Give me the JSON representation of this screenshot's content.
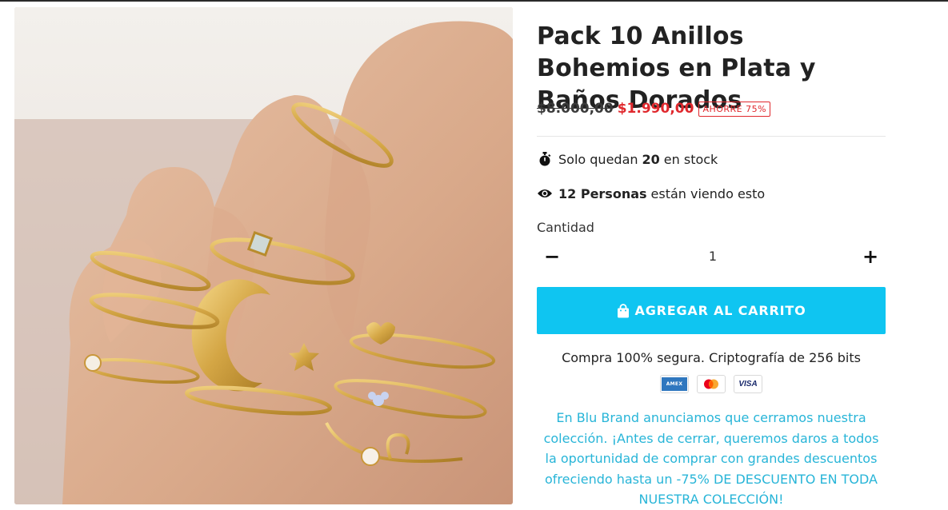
{
  "product": {
    "title": "Pack 10 Anillos Bohemios en Plata y Baños Dorados",
    "image_alt": "rings-on-hand-photo"
  },
  "pricing": {
    "old_price": "$8.000,00",
    "new_price": "$1.990,00",
    "save_badge": "AHORRE 75%"
  },
  "stock": {
    "prefix": "Solo quedan",
    "count": "20",
    "suffix": "en stock",
    "icon": "stopwatch-icon"
  },
  "viewers": {
    "count_label": "12 Personas",
    "suffix": "están viendo esto",
    "icon": "eye-icon"
  },
  "quantity": {
    "label": "Cantidad",
    "value": "1",
    "minus": "−",
    "plus": "+"
  },
  "cart_button": {
    "label": "AGREGAR AL CARRITO",
    "color": "#0fc5f1",
    "icon": "shopping-bag-icon"
  },
  "secure": {
    "text": "Compra 100% segura. Criptografía de 256 bits"
  },
  "payment_cards": [
    {
      "name": "amex",
      "label": "AMEX"
    },
    {
      "name": "mastercard",
      "label": ""
    },
    {
      "name": "visa",
      "label": "VISA"
    }
  ],
  "promo": {
    "text": "En Blu Brand anunciamos que cerramos nuestra colección. ¡Antes de cerrar, queremos daros a todos la oportunidad de comprar con grandes descuentos ofreciendo hasta un -75% DE DESCUENTO EN TODA NUESTRA COLECCIÓN!",
    "color": "#28b5d8"
  },
  "colors": {
    "sale_red": "#e0282d",
    "text": "#1d1d1d"
  }
}
